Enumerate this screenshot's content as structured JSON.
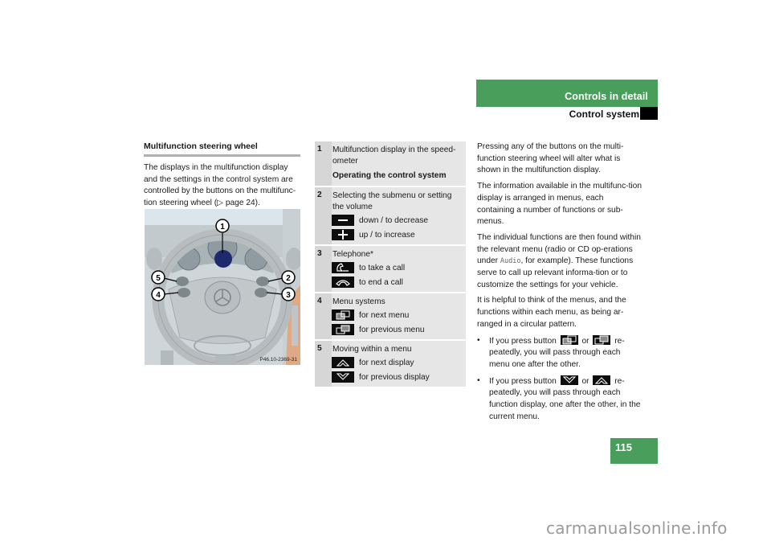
{
  "header": {
    "section": "Controls in detail",
    "subsection": "Control system"
  },
  "page_number": "115",
  "left": {
    "title": "Multifunction steering wheel",
    "intro": "The displays in the multifunction display and the settings in the control system are controlled by the buttons on the multifunc-tion steering wheel (▷ page 24).",
    "figure": {
      "code": "P46.10-2369-31",
      "callouts": [
        "1",
        "2",
        "3",
        "4",
        "5"
      ]
    }
  },
  "table": {
    "rows": [
      {
        "num": "1",
        "lines": [
          "Multifunction display in the speed-ometer"
        ],
        "heading": "Operating the control system",
        "keys": []
      },
      {
        "num": "2",
        "lines": [
          "Selecting the submenu or setting the volume"
        ],
        "keys": [
          {
            "icon": "minus-icon",
            "label": "down / to decrease"
          },
          {
            "icon": "plus-icon",
            "label": "up / to increase"
          }
        ]
      },
      {
        "num": "3",
        "lines": [
          "Telephone*"
        ],
        "keys": [
          {
            "icon": "phone-pickup-icon",
            "label": "to take a call"
          },
          {
            "icon": "phone-hangup-icon",
            "label": "to end a call"
          }
        ]
      },
      {
        "num": "4",
        "lines": [
          "Menu systems"
        ],
        "keys": [
          {
            "icon": "next-menu-icon",
            "label": "for next menu"
          },
          {
            "icon": "previous-menu-icon",
            "label": "for previous menu"
          }
        ]
      },
      {
        "num": "5",
        "lines": [
          "Moving within a menu"
        ],
        "keys": [
          {
            "icon": "up-arrow-icon",
            "label": "for next display"
          },
          {
            "icon": "down-arrow-icon",
            "label": "for previous display"
          }
        ]
      }
    ]
  },
  "right": {
    "p1": "Pressing any of the buttons on the multi-function steering wheel will alter what is shown in the multifunction display.",
    "p2": "The information available in the multifunc-tion display is arranged in menus, each containing a number of functions or sub-menus.",
    "p3_a": "The individual functions are then found within the relevant menu (radio or CD op-erations under ",
    "p3_code": "Audio",
    "p3_b": ", for example). These functions serve to call up relevant informa-tion or to customize the settings for your vehicle.",
    "p4": "It is helpful to think of the menus, and the functions within each menu, as being ar-ranged in a circular pattern.",
    "bullets": [
      {
        "a": "If you press button ",
        "or": " or ",
        "b": " re-peatedly, you will pass through each menu one after the other."
      },
      {
        "a": "If you press button ",
        "or": " or ",
        "b": " re-peatedly, you will pass through each function display, one after the other, in the current menu."
      }
    ]
  },
  "watermark": "carmanualsonline.info",
  "colors": {
    "accent_green": "#4a9e5c",
    "table_bg": "#e6e6e6",
    "table_num_bg": "#d6d6d6"
  }
}
